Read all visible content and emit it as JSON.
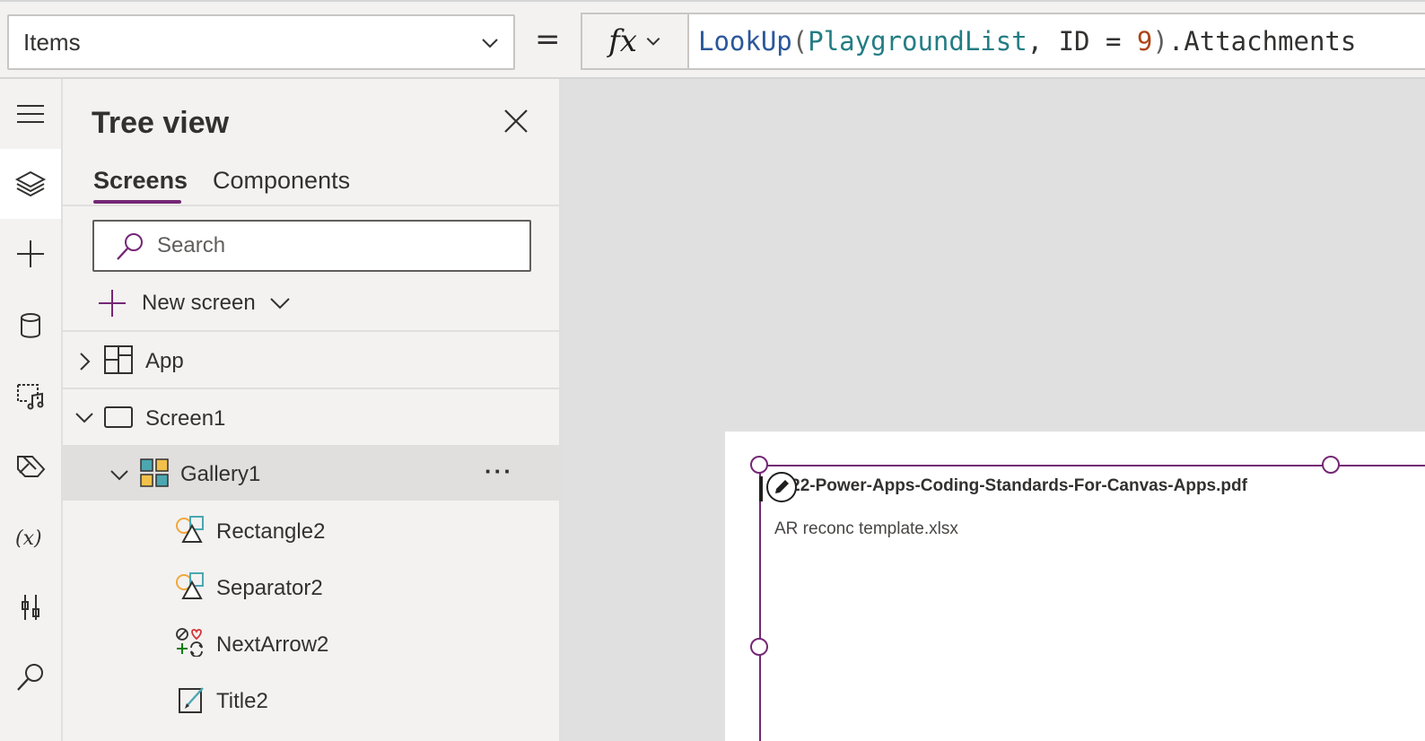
{
  "formula_bar": {
    "property": "Items",
    "equals": "=",
    "fx_label": "fx",
    "formula_tokens": [
      {
        "text": "LookUp",
        "kind": "fn"
      },
      {
        "text": "(",
        "kind": "op"
      },
      {
        "text": "PlaygroundList",
        "kind": "id"
      },
      {
        "text": ", ID = ",
        "kind": "txt"
      },
      {
        "text": "9",
        "kind": "num"
      },
      {
        "text": ")",
        "kind": "op"
      },
      {
        "text": ".Attachments",
        "kind": "txt"
      }
    ]
  },
  "rail": {
    "items": [
      {
        "icon": "hamburger-menu-icon"
      },
      {
        "icon": "layers-icon",
        "active": true
      },
      {
        "icon": "plus-icon"
      },
      {
        "icon": "database-icon"
      },
      {
        "icon": "media-icon"
      },
      {
        "icon": "power-automate-icon"
      },
      {
        "icon": "variables-icon"
      },
      {
        "icon": "advanced-tools-icon"
      },
      {
        "icon": "search-icon"
      }
    ]
  },
  "tree": {
    "title": "Tree view",
    "tabs": [
      {
        "label": "Screens",
        "active": true
      },
      {
        "label": "Components",
        "active": false
      }
    ],
    "search_placeholder": "Search",
    "new_screen_label": "New screen",
    "nodes": {
      "app": "App",
      "screen1": "Screen1",
      "gallery1": "Gallery1",
      "rectangle2": "Rectangle2",
      "separator2": "Separator2",
      "nextarrow2": "NextArrow2",
      "title2": "Title2"
    },
    "more_label": "···"
  },
  "canvas": {
    "gallery_items": [
      "2022-Power-Apps-Coding-Standards-For-Canvas-Apps.pdf",
      "AR reconc template.xlsx"
    ]
  },
  "colors": {
    "accent": "#742774",
    "panel_bg": "#f3f2f1",
    "canvas_bg": "#e0e0e0"
  }
}
